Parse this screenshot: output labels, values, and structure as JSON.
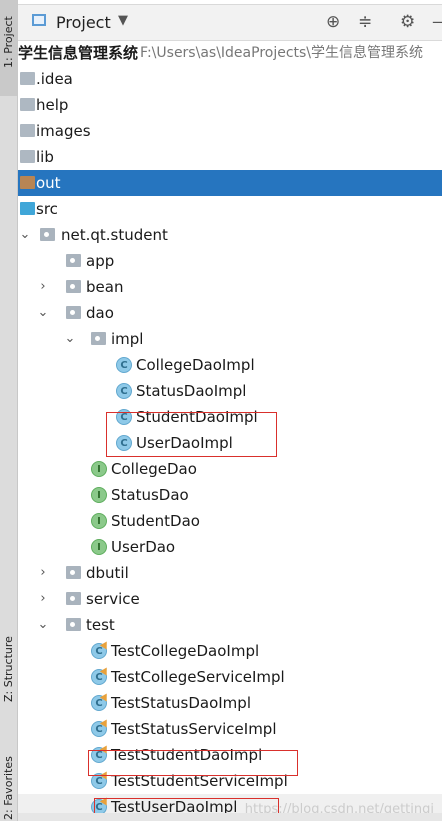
{
  "side_tabs": {
    "project": "1: Project",
    "structure": "Z: Structure",
    "favorites": "2: Favorites"
  },
  "toolbar": {
    "title": "Project",
    "caret": "▼",
    "locate_icon": "⊕",
    "collapse_icon": "≑",
    "settings_icon": "⚙",
    "hide_icon": "—"
  },
  "root": {
    "name": "学生信息管理系统",
    "path": "F:\\Users\\as\\IdeaProjects\\学生信息管理系统"
  },
  "tree": [
    {
      "label": ".idea"
    },
    {
      "label": "help"
    },
    {
      "label": "images"
    },
    {
      "label": "lib"
    },
    {
      "label": "out"
    },
    {
      "label": "src"
    },
    {
      "label": "net.qt.student"
    },
    {
      "label": "app"
    },
    {
      "label": "bean"
    },
    {
      "label": "dao"
    },
    {
      "label": "impl"
    },
    {
      "label": "CollegeDaoImpl"
    },
    {
      "label": "StatusDaoImpl"
    },
    {
      "label": "StudentDaoImpl"
    },
    {
      "label": "UserDaoImpl"
    },
    {
      "label": "CollegeDao"
    },
    {
      "label": "StatusDao"
    },
    {
      "label": "StudentDao"
    },
    {
      "label": "UserDao"
    },
    {
      "label": "dbutil"
    },
    {
      "label": "service"
    },
    {
      "label": "test"
    },
    {
      "label": "TestCollegeDaoImpl"
    },
    {
      "label": "TestCollegeServiceImpl"
    },
    {
      "label": "TestStatusDaoImpl"
    },
    {
      "label": "TestStatusServiceImpl"
    },
    {
      "label": "TestStudentDaoImpl"
    },
    {
      "label": "TestStudentServiceImpl"
    },
    {
      "label": "TestUserDaoImpl"
    }
  ],
  "badges": {
    "class": "C",
    "interface": "I"
  },
  "arrows": {
    "expanded": "⌄",
    "collapsed": "›"
  },
  "watermark": "https://blog.csdn.net/gettingi",
  "colors": {
    "selection": "#2675bf",
    "highlight_box": "#d9302c"
  }
}
